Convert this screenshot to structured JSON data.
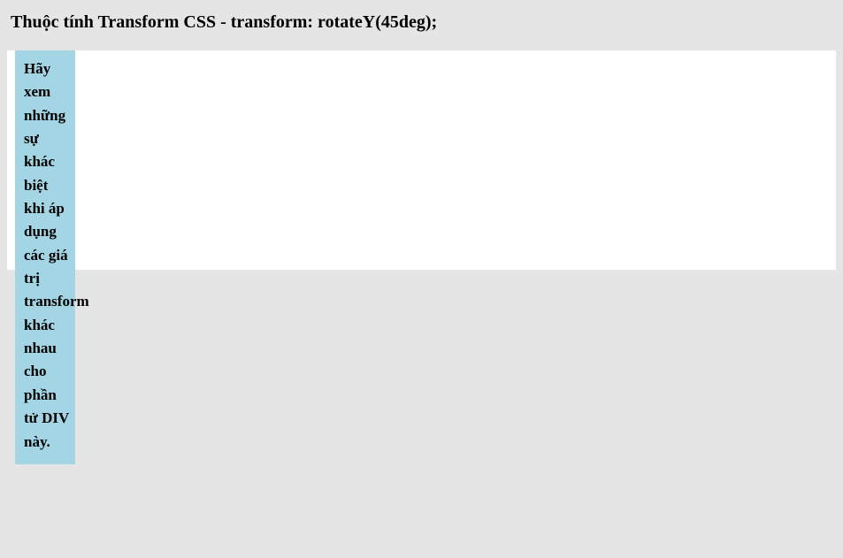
{
  "heading": "Thuộc tính Transform CSS - transform: rotateY(45deg);",
  "box_text": "Hãy xem những sự khác biệt khi áp dụng các giá trị transform khác nhau cho phần tử DIV này."
}
